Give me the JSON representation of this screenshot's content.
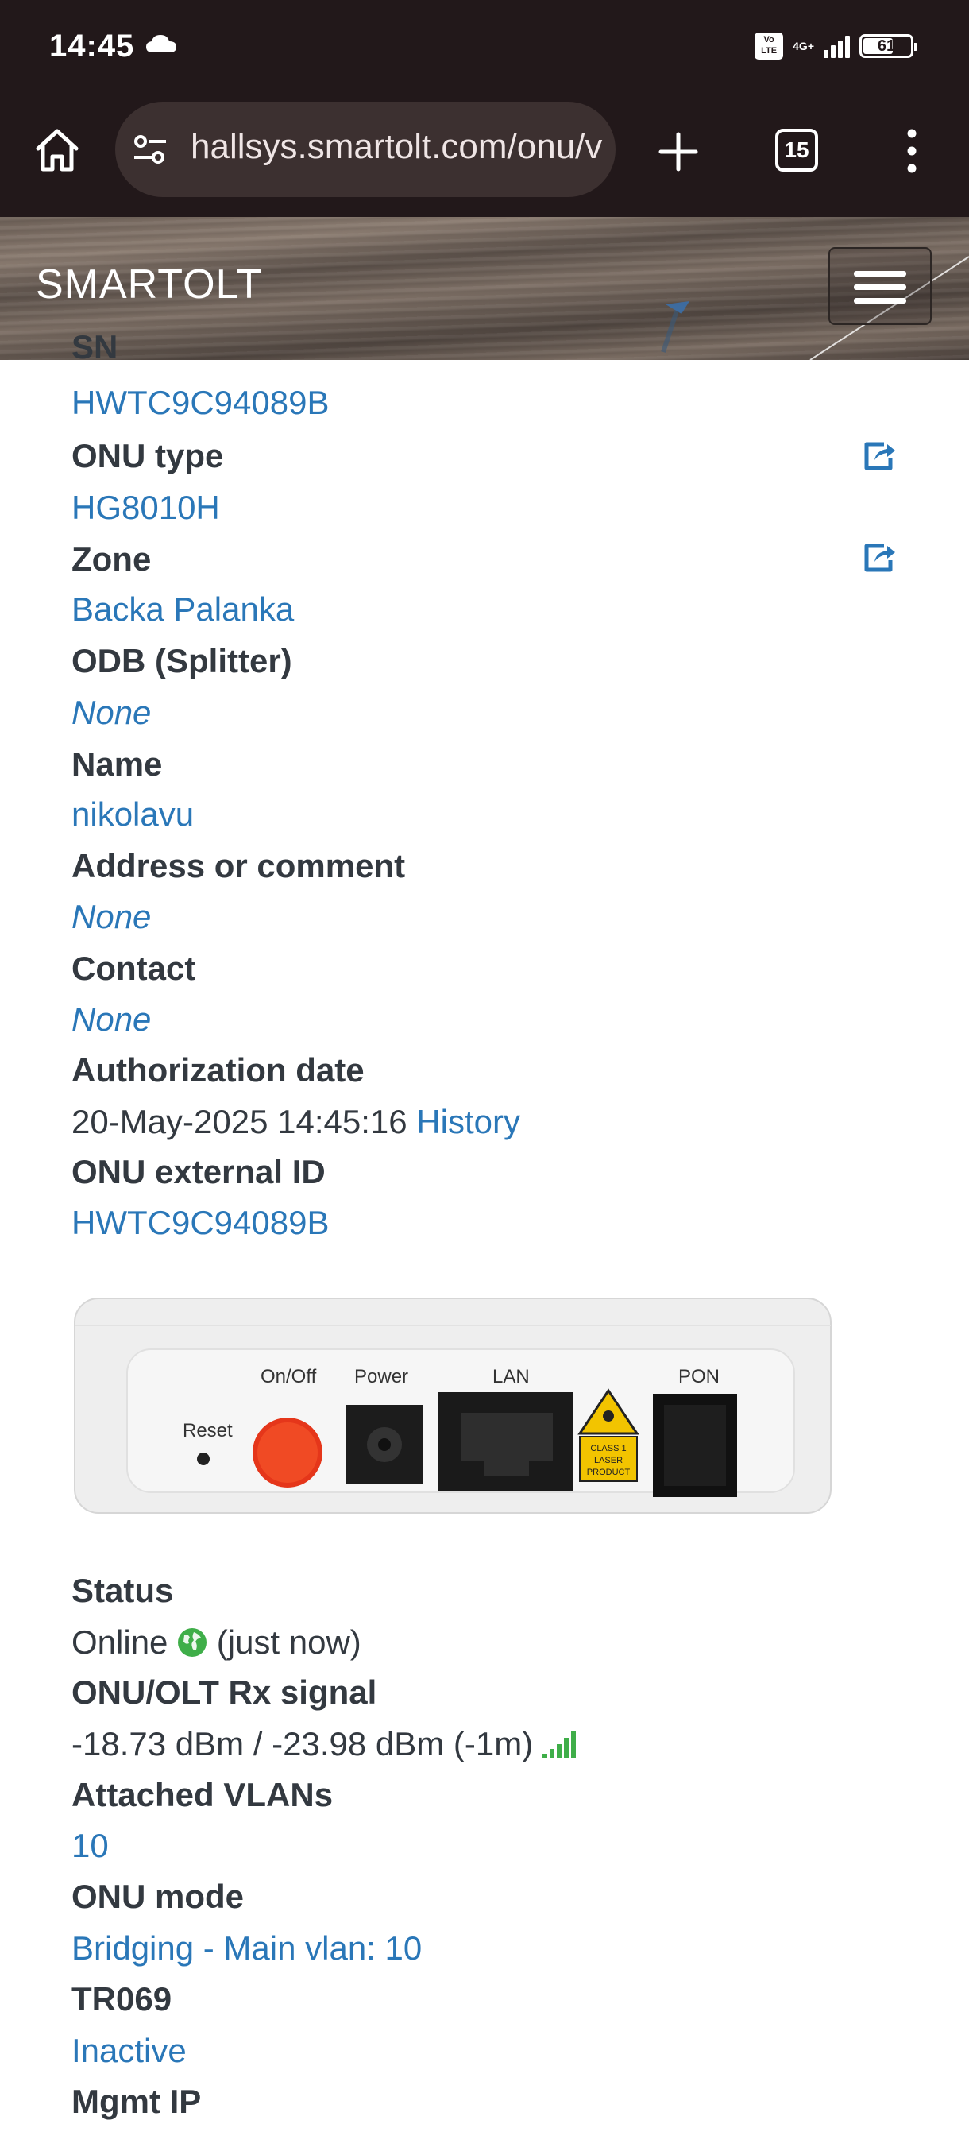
{
  "status_bar": {
    "time": "14:45",
    "volte": "Vo LTE",
    "network": "4G+",
    "battery": "61"
  },
  "browser": {
    "url": "hallsys.smartolt.com/onu/view/",
    "tab_count": "15"
  },
  "navbar": {
    "brand": "SMARTOLT"
  },
  "fields": {
    "sn_label": "SN",
    "sn_value": "HWTC9C94089B",
    "onu_type_label": "ONU type",
    "onu_type_value": "HG8010H",
    "zone_label": "Zone",
    "zone_value": "Backa Palanka",
    "odb_label": "ODB (Splitter)",
    "odb_value": "None",
    "name_label": "Name",
    "name_value": "nikolavu",
    "address_label": "Address or comment",
    "address_value": "None",
    "contact_label": "Contact",
    "contact_value": "None",
    "auth_date_label": "Authorization date",
    "auth_date_value": "20-May-2025 14:45:16",
    "history_link": "History",
    "external_id_label": "ONU external ID",
    "external_id_value": "HWTC9C94089B",
    "status_label": "Status",
    "status_value": "Online",
    "status_time": "(just now)",
    "rx_label": "ONU/OLT Rx signal",
    "rx_value": "-18.73 dBm / -23.98 dBm (-1m)",
    "vlans_label": "Attached VLANs",
    "vlans_value": "10",
    "mode_label": "ONU mode",
    "mode_value": "Bridging - Main vlan: 10",
    "tr069_label": "TR069",
    "tr069_value": "Inactive",
    "mgmt_ip_label": "Mgmt IP"
  },
  "device_image": {
    "reset": "Reset",
    "on_off": "On/Off",
    "power": "Power",
    "lan": "LAN",
    "laser_line1": "CLASS 1",
    "laser_line2": "LASER",
    "laser_line3": "PRODUCT",
    "pon": "PON"
  },
  "colors": {
    "link": "#2a77b8",
    "label": "#333940",
    "status_online": "#3fae49",
    "signal": "#3fae49",
    "chrome": "#22181a"
  },
  "icons": {
    "home": "home-icon",
    "site_settings": "tune-icon",
    "new_tab": "plus-icon",
    "menu": "more-vert-icon",
    "share": "share-square-icon",
    "globe": "globe-icon",
    "signal": "signal-bars-icon"
  }
}
